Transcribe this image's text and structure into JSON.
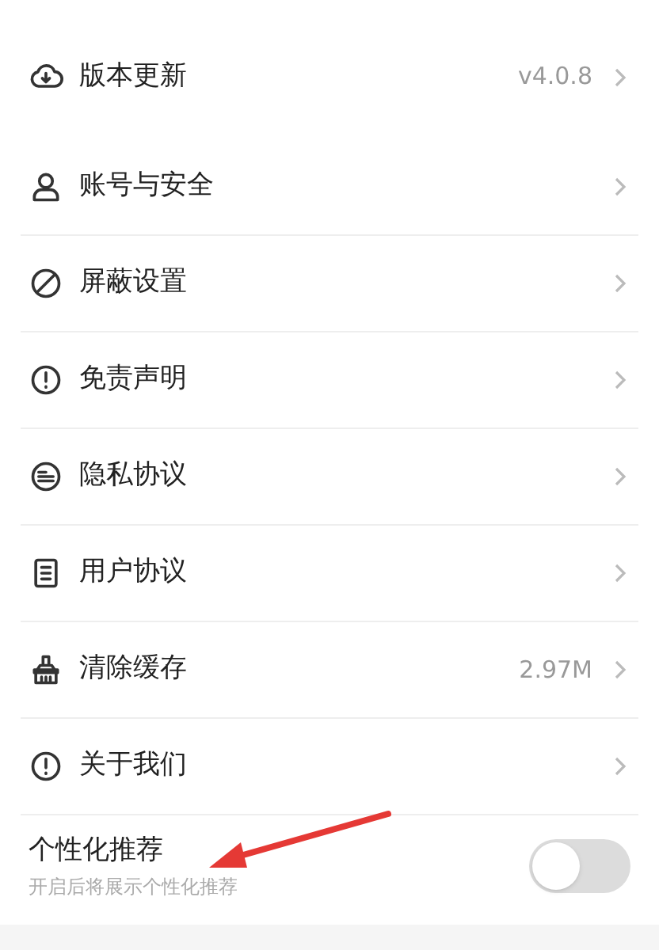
{
  "sections": [
    {
      "items": [
        {
          "kind": "download",
          "label": "版本更新",
          "value": "v4.0.8"
        }
      ]
    },
    {
      "items": [
        {
          "kind": "user",
          "label": "账号与安全"
        },
        {
          "kind": "ban",
          "label": "屏蔽设置"
        },
        {
          "kind": "alert",
          "label": "免责声明"
        },
        {
          "kind": "lines",
          "label": "隐私协议"
        },
        {
          "kind": "doc",
          "label": "用户协议"
        },
        {
          "kind": "broom",
          "label": "清除缓存",
          "value": "2.97M"
        },
        {
          "kind": "alert",
          "label": "关于我们"
        }
      ]
    }
  ],
  "personalized": {
    "title": "个性化推荐",
    "subtitle": "开启后将展示个性化推荐",
    "on": false
  }
}
